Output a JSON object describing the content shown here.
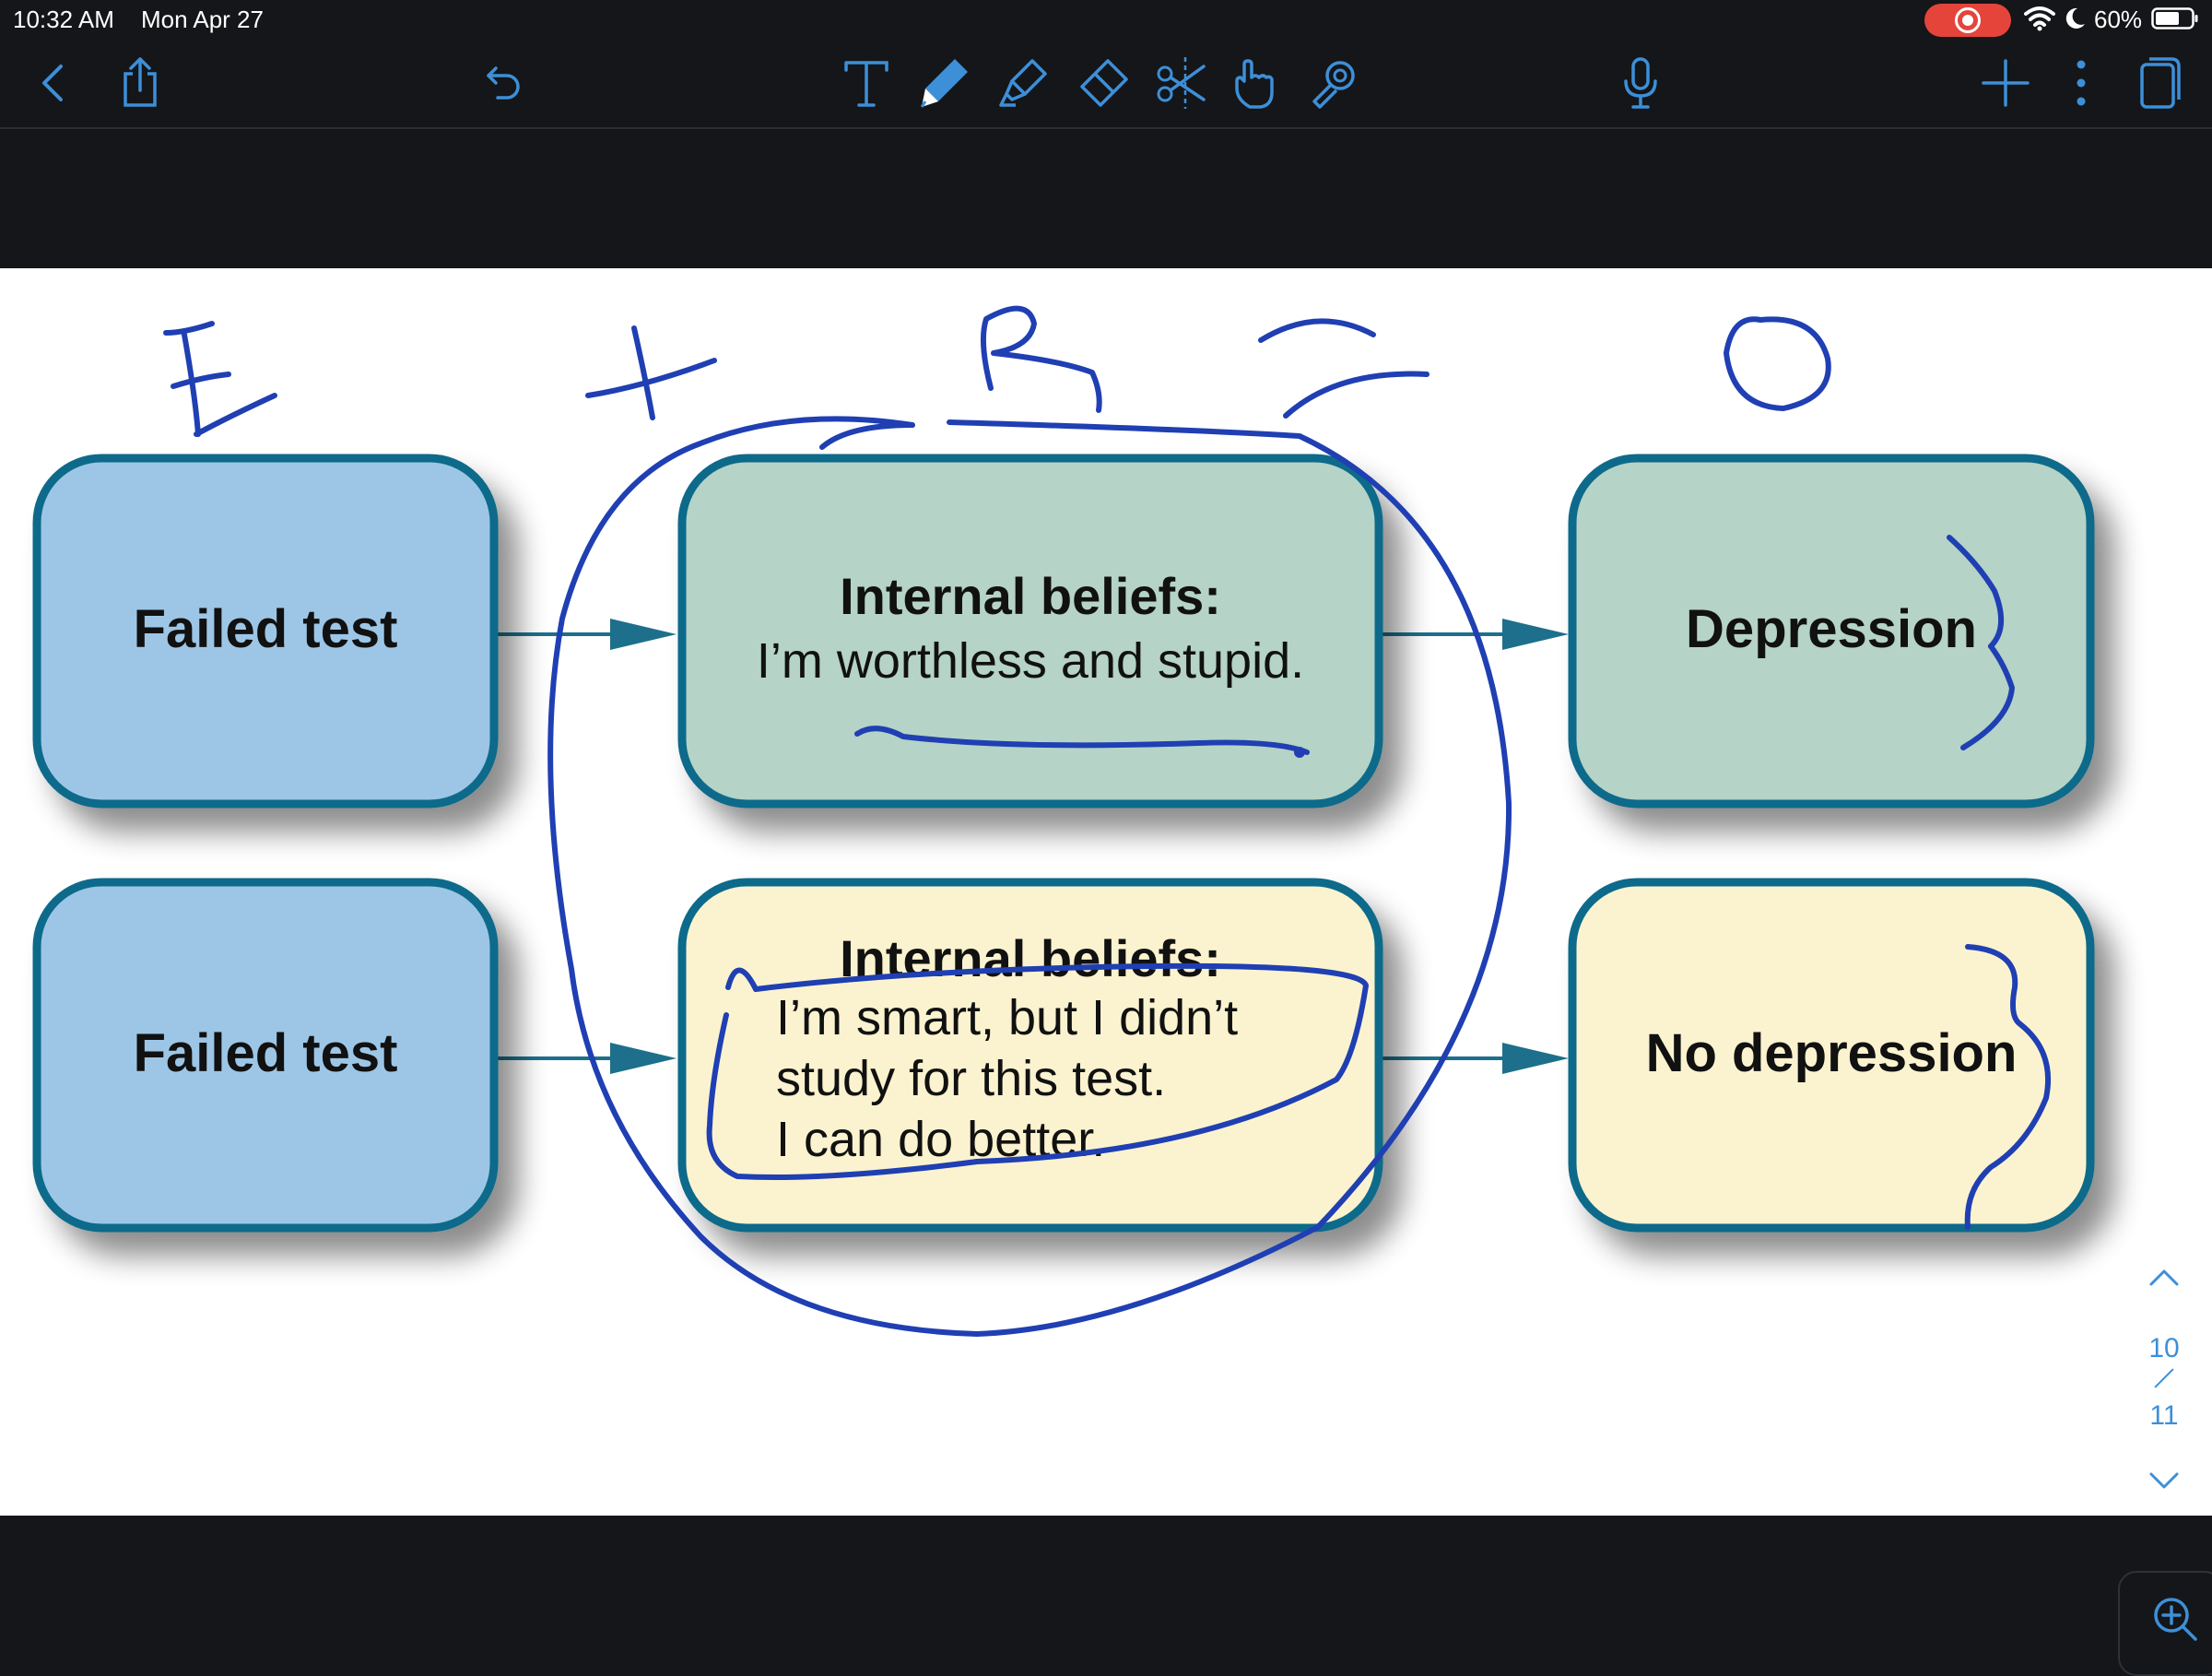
{
  "status_bar": {
    "time": "10:32 AM",
    "date": "Mon Apr 27",
    "battery": "60%"
  },
  "toolbar": {
    "icons": [
      "back-icon",
      "share-icon",
      "undo-icon",
      "text-tool-icon",
      "pen-tool-icon",
      "highlighter-tool-icon",
      "eraser-tool-icon",
      "lasso-scissors-icon",
      "hand-pointer-icon",
      "laser-pointer-icon",
      "microphone-icon",
      "add-icon",
      "more-icon",
      "pages-icon"
    ],
    "accent": "#3d8fd8"
  },
  "diagram": {
    "rows": [
      {
        "event": "Failed test",
        "belief_title": "Internal beliefs:",
        "belief_lines": [
          "I’m worthless and stupid."
        ],
        "outcome": "Depression"
      },
      {
        "event": "Failed test",
        "belief_title": "Internal beliefs:",
        "belief_lines": [
          "I’m smart, but I didn’t",
          "study for this test.",
          "I can do better."
        ],
        "outcome": "No depression"
      }
    ],
    "colors": {
      "event_fill": "#9dc6e6",
      "belief1_fill": "#b5d3c6",
      "belief2_fill": "#fbf3cf",
      "border": "#0f6b8a"
    }
  },
  "annotations": {
    "letters": [
      "E",
      "+",
      "R",
      "=",
      "O"
    ],
    "ink_color": "#1f3fb3"
  },
  "pagination": {
    "current": "10",
    "total": "11"
  }
}
